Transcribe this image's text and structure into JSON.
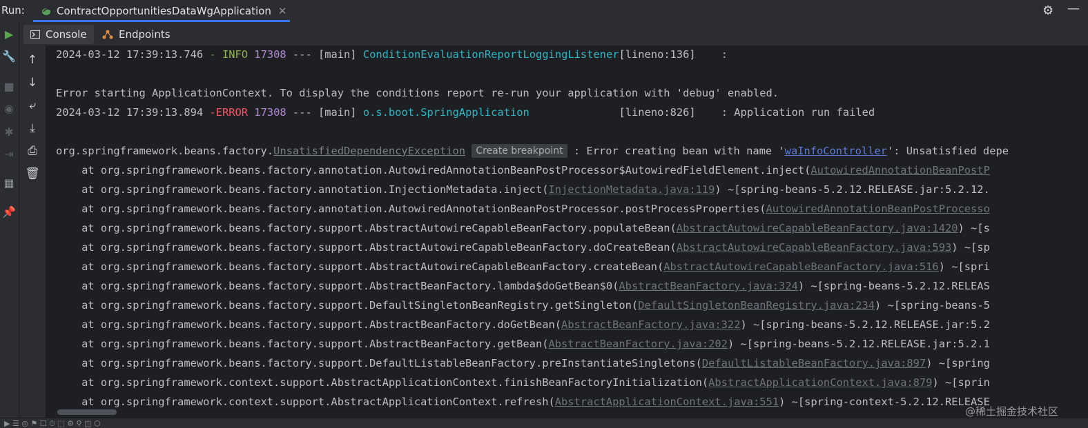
{
  "run_header": {
    "label": "Run:",
    "tab_title": "ContractOpportunitiesDataWgApplication",
    "close_glyph": "✕"
  },
  "tabs": [
    {
      "label": "Console",
      "icon": "console-icon"
    },
    {
      "label": "Endpoints",
      "icon": "endpoints-icon"
    }
  ],
  "console_lines": {
    "l1": {
      "ts": "2024-03-12 17:39:13.746",
      "sep": " - ",
      "level": "INFO",
      "pid": "17308",
      "mid": " --- [main] ",
      "logger": "ConditionEvaluationReportLoggingListener",
      "tail": "[lineno:136]    :"
    },
    "l2": "Error starting ApplicationContext. To display the conditions report re-run your application with 'debug' enabled.",
    "l3": {
      "ts": "2024-03-12 17:39:13.894",
      "sep": " -",
      "level": "ERROR",
      "pid": "17308",
      "mid": " --- [main] ",
      "logger": "o.s.boot.SpringApplication",
      "pad": "              ",
      "tail": "[lineno:826]    : Application run failed"
    },
    "l4": {
      "pre": "org.springframework.beans.factory.",
      "exc": "UnsatisfiedDependencyException",
      "popup": "Create breakpoint",
      "mid": " : Error creating bean with name '",
      "bean": "waInfoController",
      "tail": "': Unsatisfied depe"
    }
  },
  "stack": [
    {
      "m": "    at org.springframework.beans.factory.annotation.AutowiredAnnotationBeanPostProcessor$AutowiredFieldElement.inject(",
      "l": "AutowiredAnnotationBeanPostP",
      "t": ""
    },
    {
      "m": "    at org.springframework.beans.factory.annotation.InjectionMetadata.inject(",
      "l": "InjectionMetadata.java:119",
      "t": ") ~[spring-beans-5.2.12.RELEASE.jar:5.2.12."
    },
    {
      "m": "    at org.springframework.beans.factory.annotation.AutowiredAnnotationBeanPostProcessor.postProcessProperties(",
      "l": "AutowiredAnnotationBeanPostProcesso",
      "t": ""
    },
    {
      "m": "    at org.springframework.beans.factory.support.AbstractAutowireCapableBeanFactory.populateBean(",
      "l": "AbstractAutowireCapableBeanFactory.java:1420",
      "t": ") ~[s"
    },
    {
      "m": "    at org.springframework.beans.factory.support.AbstractAutowireCapableBeanFactory.doCreateBean(",
      "l": "AbstractAutowireCapableBeanFactory.java:593",
      "t": ") ~[sp"
    },
    {
      "m": "    at org.springframework.beans.factory.support.AbstractAutowireCapableBeanFactory.createBean(",
      "l": "AbstractAutowireCapableBeanFactory.java:516",
      "t": ") ~[spri"
    },
    {
      "m": "    at org.springframework.beans.factory.support.AbstractBeanFactory.lambda$doGetBean$0(",
      "l": "AbstractBeanFactory.java:324",
      "t": ") ~[spring-beans-5.2.12.RELEAS"
    },
    {
      "m": "    at org.springframework.beans.factory.support.DefaultSingletonBeanRegistry.getSingleton(",
      "l": "DefaultSingletonBeanRegistry.java:234",
      "t": ") ~[spring-beans-5"
    },
    {
      "m": "    at org.springframework.beans.factory.support.AbstractBeanFactory.doGetBean(",
      "l": "AbstractBeanFactory.java:322",
      "t": ") ~[spring-beans-5.2.12.RELEASE.jar:5.2"
    },
    {
      "m": "    at org.springframework.beans.factory.support.AbstractBeanFactory.getBean(",
      "l": "AbstractBeanFactory.java:202",
      "t": ") ~[spring-beans-5.2.12.RELEASE.jar:5.2.1"
    },
    {
      "m": "    at org.springframework.beans.factory.support.DefaultListableBeanFactory.preInstantiateSingletons(",
      "l": "DefaultListableBeanFactory.java:897",
      "t": ") ~[spring"
    },
    {
      "m": "    at org.springframework.context.support.AbstractApplicationContext.finishBeanFactoryInitialization(",
      "l": "AbstractApplicationContext.java:879",
      "t": ") ~[sprin"
    },
    {
      "m": "    at org.springframework.context.support.AbstractApplicationContext.refresh(",
      "l": "AbstractApplicationContext.java:551",
      "t": ") ~[spring-context-5.2.12.RELEASE"
    }
  ],
  "watermark": "@稀土掘金技术社区",
  "colors": {
    "accent": "#3574f0",
    "console_bg": "#1e1f22",
    "panel_bg": "#2b2d30",
    "info": "#8fb34d",
    "error": "#f75464",
    "logger": "#2fb6c4",
    "pid": "#b089d6",
    "link": "#5a7bd6"
  },
  "icons": {
    "left_stripe": [
      "run-icon",
      "wrench-icon",
      "stop-icon",
      "camera-icon",
      "debug-icon",
      "exit-icon",
      "layout-icon",
      "pin-icon"
    ],
    "console_toolbar": [
      "up-arrow-icon",
      "down-arrow-icon",
      "soft-wrap-icon",
      "scroll-to-end-icon",
      "print-icon",
      "trash-icon"
    ],
    "header": [
      "gear-icon",
      "minimize-icon"
    ]
  }
}
